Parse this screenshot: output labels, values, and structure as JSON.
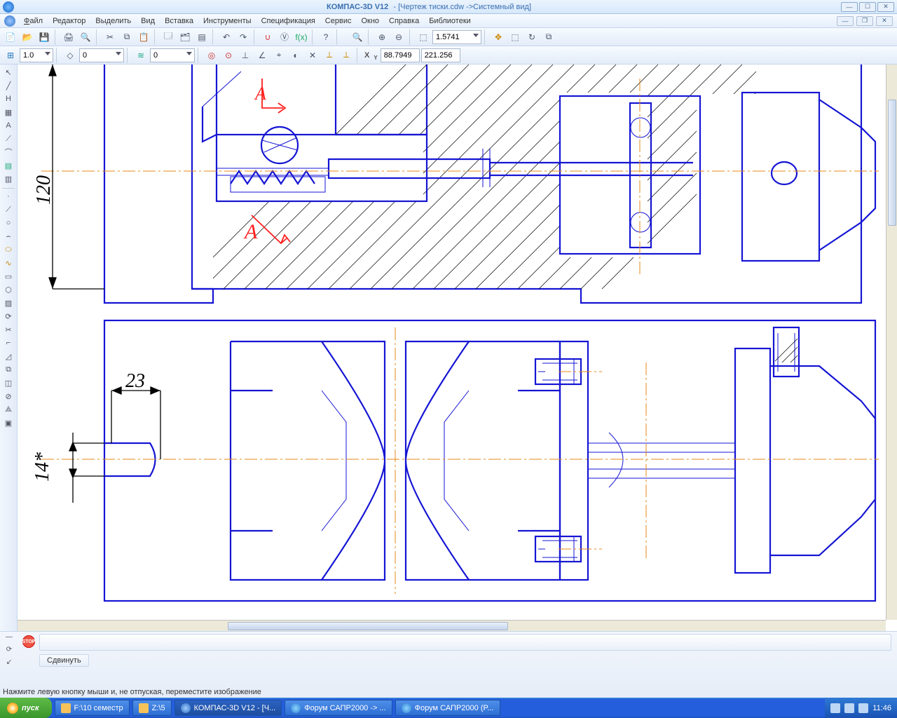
{
  "title": {
    "app": "КОМПАС-3D V12",
    "doc": " - [Чертеж тиски.cdw ->Системный вид]"
  },
  "menu": {
    "file": "Файл",
    "edit": "Редактор",
    "select": "Выделить",
    "view": "Вид",
    "insert": "Вставка",
    "tools": "Инструменты",
    "spec": "Спецификация",
    "service": "Сервис",
    "window": "Окно",
    "help": "Справка",
    "libs": "Библиотеки"
  },
  "tb1": {
    "zoom": "1.5741"
  },
  "tb2": {
    "size": "1.0",
    "layer": "0",
    "style": "0",
    "x": "88.7949",
    "y": "221.256"
  },
  "dims": {
    "d120": "120",
    "d23": "23",
    "d14": "14*",
    "markA1": "А",
    "markA2": "А"
  },
  "bottom": {
    "tab": "Сдвинуть",
    "hint": "Нажмите левую кнопку мыши и, не отпуская, переместите изображение",
    "stop": "STOP"
  },
  "taskbar": {
    "start": "пуск",
    "t1": "F:\\10 семестр",
    "t2": "Z:\\5",
    "t3": "КОМПАС-3D V12 - [Ч...",
    "t4": "Форум САПР2000 -> ...",
    "t5": "Форум САПР2000 (P...",
    "clock": "11:46"
  }
}
